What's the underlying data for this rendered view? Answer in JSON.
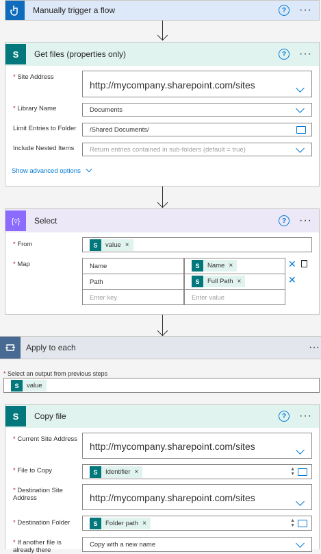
{
  "trigger": {
    "title": "Manually trigger a flow",
    "help": "?",
    "more": "···"
  },
  "get_files": {
    "title": "Get files (properties only)",
    "site_address_label": "Site Address",
    "site_address_value": "http://mycompany.sharepoint.com/sites",
    "library_name_label": "Library Name",
    "library_name_value": "Documents",
    "limit_folder_label": "Limit Entries to Folder",
    "limit_folder_value": "/Shared Documents/",
    "nested_label": "Include Nested Items",
    "nested_placeholder": "Return entries contained in sub-folders (default = true)",
    "advanced": "Show advanced options"
  },
  "select": {
    "title": "Select",
    "from_label": "From",
    "from_token": "value",
    "map_label": "Map",
    "rows": [
      {
        "key": "Name",
        "value_token": "Name"
      },
      {
        "key": "Path",
        "value_token": "Full Path"
      }
    ],
    "key_placeholder": "Enter key",
    "value_placeholder": "Enter value"
  },
  "apply": {
    "title": "Apply to each",
    "output_label": "Select an output from previous steps",
    "token": "value"
  },
  "copy_file": {
    "title": "Copy file",
    "current_site_label": "Current Site Address",
    "current_site_value": "http://mycompany.sharepoint.com/sites",
    "file_label": "File to Copy",
    "file_token": "Identifier",
    "dest_site_label": "Destination Site Address",
    "dest_site_value": "http://mycompany.sharepoint.com/sites",
    "dest_folder_label": "Destination Folder",
    "dest_folder_token": "Folder path",
    "if_exists_label": "If another file is already there",
    "if_exists_value": "Copy with a new name"
  },
  "colors": {
    "trigger": "#dde9f8",
    "sharepoint": "#e1f3ef",
    "select": "#ece8f8",
    "apply": "#e3e6ec",
    "accent": "#0078d4"
  }
}
